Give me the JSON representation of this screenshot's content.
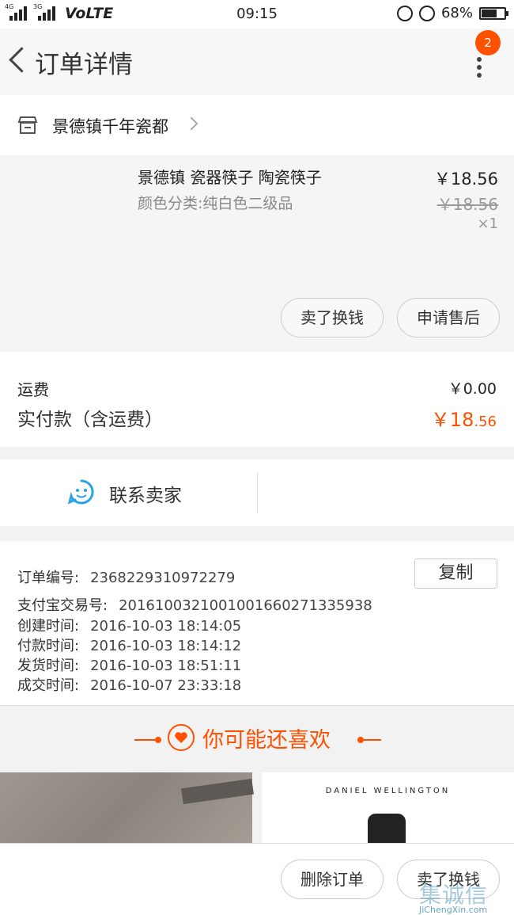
{
  "status": {
    "signal1": "4G",
    "signal2": "3G",
    "network": "VoLTE",
    "time": "09:15",
    "battery": "68%",
    "battery_level": 0.68
  },
  "header": {
    "title": "订单详情",
    "badge_count": "2"
  },
  "store": {
    "name": "景德镇千年瓷都"
  },
  "item": {
    "title": "景德镇 瓷器筷子 陶瓷筷子",
    "sku": "颜色分类:纯白色二级品",
    "price": "￥18.56",
    "original_price": "￥18.56",
    "quantity": "×1",
    "buttons": [
      "卖了换钱",
      "申请售后"
    ]
  },
  "fees": {
    "shipping_label": "运费",
    "shipping_value": "￥0.00",
    "paid_label": "实付款（含运费）",
    "paid_int": "￥18",
    "paid_dec": ".56"
  },
  "contact": {
    "label": "联系卖家"
  },
  "order_info": {
    "copy_label": "复制",
    "rows": [
      {
        "label": "订单编号:",
        "value": "2368229310972279"
      },
      {
        "label": "支付宝交易号:",
        "value": "2016100321001001660271335938"
      },
      {
        "label": "创建时间:",
        "value": "2016-10-03  18:14:05"
      },
      {
        "label": "付款时间:",
        "value": "2016-10-03  18:14:12"
      },
      {
        "label": "发货时间:",
        "value": "2016-10-03  18:51:11"
      },
      {
        "label": "成交时间:",
        "value": "2016-10-07  23:33:18"
      }
    ]
  },
  "recommend": {
    "title": "你可能还喜欢",
    "product2_brand": "DANIEL WELLINGTON"
  },
  "bottom": {
    "buttons": [
      "删除订单",
      "卖了换钱"
    ]
  },
  "watermark": {
    "text": "集诚信",
    "sub": "JiChengXin.com"
  },
  "colors": {
    "accent": "#ff5000",
    "contact_icon": "#29a3e6"
  }
}
